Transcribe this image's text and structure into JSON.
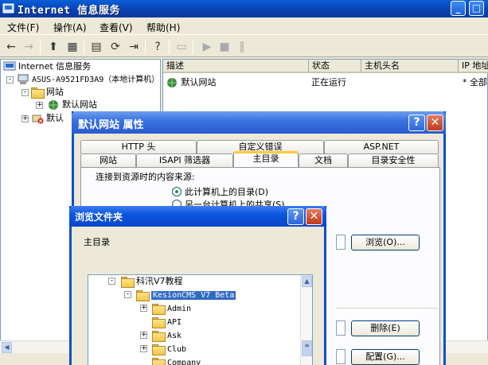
{
  "window": {
    "title": "Internet 信息服务",
    "minimize": "_",
    "maximize": "□",
    "close": "✕"
  },
  "menu": {
    "file": "文件(F)",
    "action": "操作(A)",
    "view": "查看(V)",
    "help": "帮助(H)"
  },
  "toolbar_icons": [
    "back-icon",
    "forward-icon",
    "up-icon",
    "show-tree-icon",
    "properties-icon",
    "refresh-icon",
    "export-icon",
    "help-icon",
    "computer-icon",
    "play-icon",
    "stop-icon",
    "pause-icon"
  ],
  "tree": {
    "root": "Internet 信息服务",
    "computer": "ASUS-A9521FD3A9（本地计算机）",
    "websites": "网站",
    "default_site": "默认网站",
    "default_partial": "默认"
  },
  "list": {
    "columns": [
      "描述",
      "状态",
      "主机头名",
      "IP 地址"
    ],
    "rows": [
      {
        "desc": "默认网站",
        "status": "正在运行",
        "host": "",
        "ip": "* 全部"
      }
    ]
  },
  "props_dialog": {
    "title": "默认网站 属性",
    "help": "?",
    "close": "✕",
    "tabs_row1": [
      "HTTP 头",
      "自定义错误",
      "ASP.NET"
    ],
    "tabs_row2": [
      "网站",
      "ISAPI 筛选器",
      "主目录",
      "文档",
      "目录安全性"
    ],
    "active_tab": "主目录",
    "content_source_label": "连接到资源时的内容来源:",
    "radio_local": "此计算机上的目录(D)",
    "radio_share": "另一台计算机上的共享(S)",
    "browse_btn": "浏览(O)...",
    "remove_btn": "删除(E)",
    "config_btn": "配置(G)..."
  },
  "browse_dialog": {
    "title": "浏览文件夹",
    "help": "?",
    "close": "✕",
    "label": "主目录",
    "folders": [
      {
        "name": "科汛V7教程",
        "expander": "-",
        "level": 0,
        "selected": false
      },
      {
        "name": "KesionCMS V7 Beta",
        "expander": "-",
        "level": 1,
        "selected": true
      },
      {
        "name": "Admin",
        "expander": "+",
        "level": 2,
        "selected": false
      },
      {
        "name": "API",
        "expander": "",
        "level": 2,
        "selected": false
      },
      {
        "name": "Ask",
        "expander": "+",
        "level": 2,
        "selected": false
      },
      {
        "name": "Club",
        "expander": "+",
        "level": 2,
        "selected": false
      },
      {
        "name": "Company",
        "expander": "",
        "level": 2,
        "selected": false
      }
    ]
  },
  "colors": {
    "title_blue": "#0a3fb0",
    "selection": "#316ac5",
    "active_tab_accent": "#ffc83c"
  }
}
